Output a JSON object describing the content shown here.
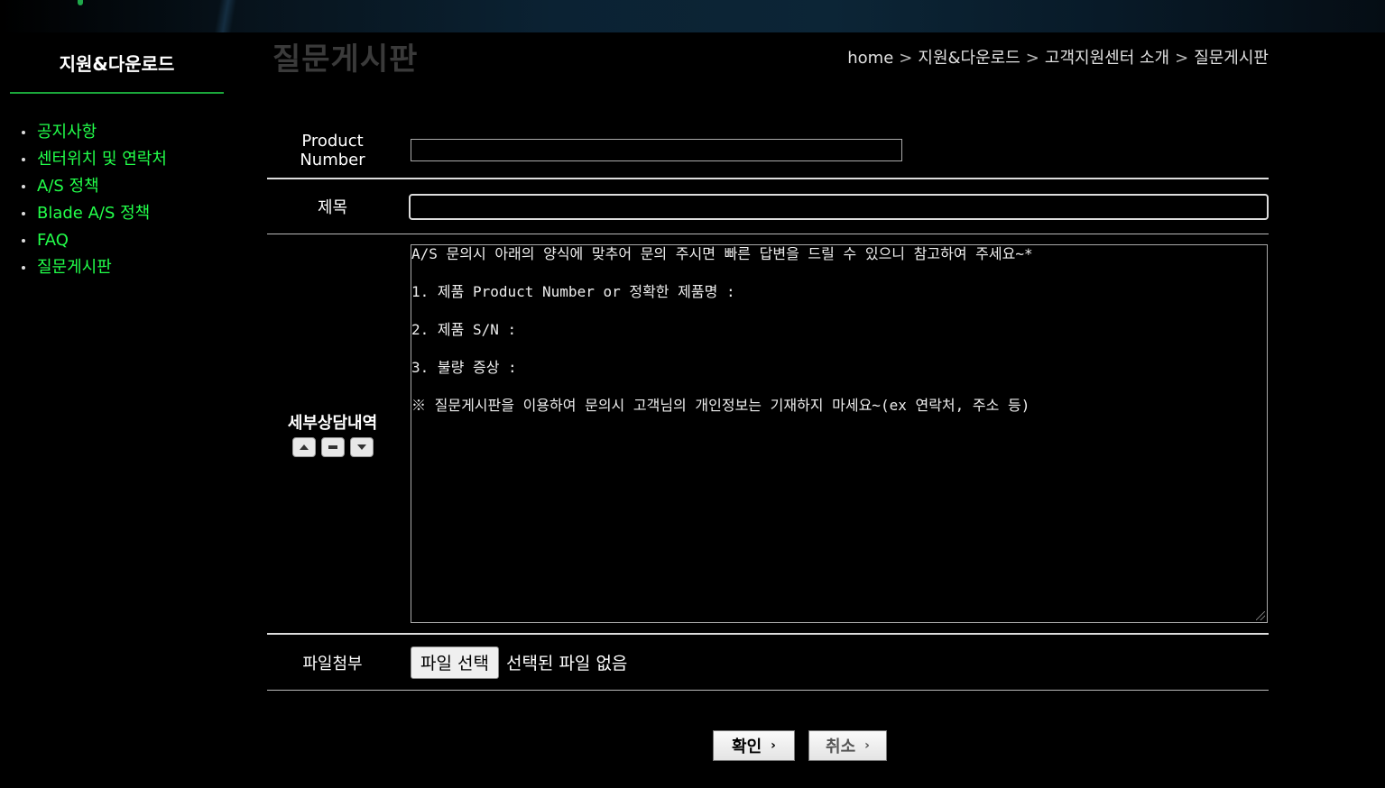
{
  "sidebar": {
    "title": "지원&다운로드",
    "items": [
      {
        "label": "공지사항"
      },
      {
        "label": "센터위치 및 연락처"
      },
      {
        "label": "A/S 정책"
      },
      {
        "label": "Blade A/S 정책"
      },
      {
        "label": "FAQ"
      },
      {
        "label": "질문게시판"
      }
    ]
  },
  "page": {
    "heading": "질문게시판",
    "breadcrumb": [
      "home",
      "지원&다운로드",
      "고객지원센터 소개",
      "질문게시판"
    ],
    "breadcrumb_sep": ">"
  },
  "form": {
    "product_label_1": "Product",
    "product_label_2": "Number",
    "product_value": "",
    "title_label": "제목",
    "title_value": "",
    "detail_label": "세부상담내역",
    "detail_lines": [
      "A/S 문의시 아래의 양식에 맞추어 문의 주시면 빠른 답변을 드릴 수 있으니 참고하여 주세요~*",
      "1. 제품 Product Number or 정확한 제품명 :",
      "2. 제품 S/N :",
      "3. 불량 증상 :",
      "※ 질문게시판을 이용하여 문의시 고객님의 개인정보는 기재하지 마세요~(ex 연락처, 주소 등)"
    ],
    "file_label": "파일첨부",
    "file_button": "파일 선택",
    "file_status": "선택된 파일 없음"
  },
  "actions": {
    "confirm": "확인",
    "cancel": "취소"
  },
  "colors": {
    "menu_green": "#22ff4a",
    "divider_green": "#1aa63a",
    "background": "#000000"
  }
}
